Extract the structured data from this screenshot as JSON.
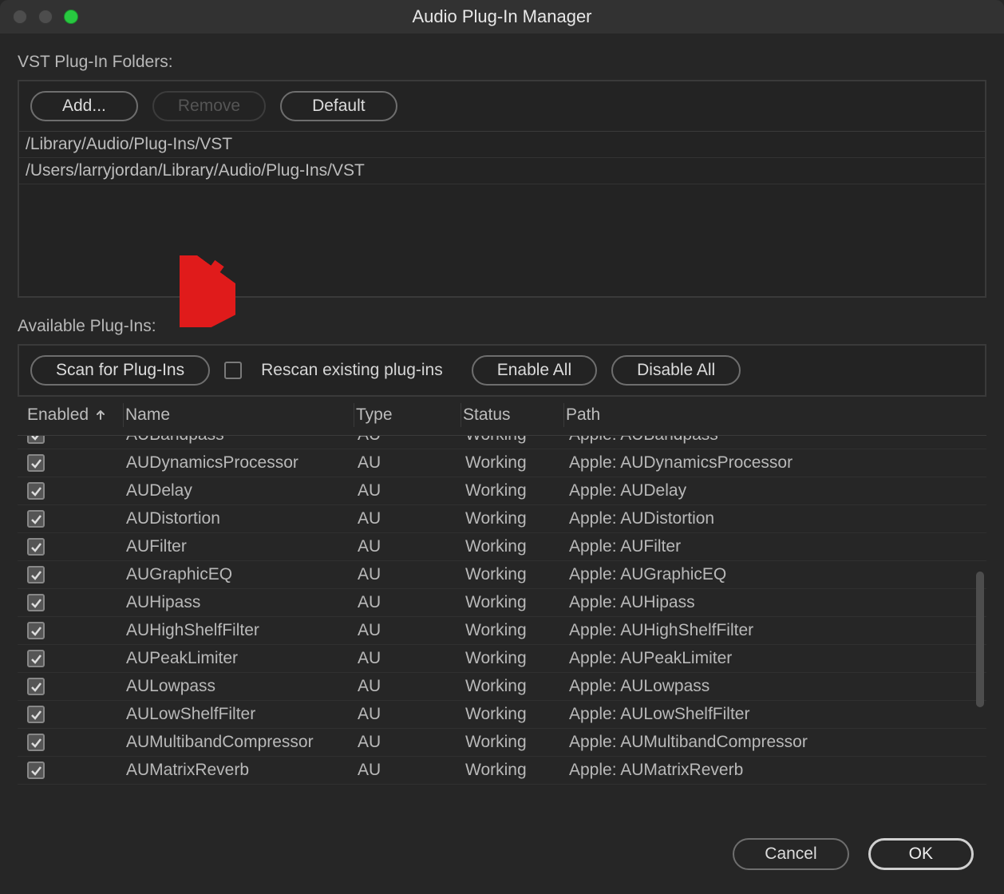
{
  "window": {
    "title": "Audio Plug-In Manager"
  },
  "folders": {
    "label": "VST Plug-In Folders:",
    "add": "Add...",
    "remove": "Remove",
    "default": "Default",
    "paths": [
      "/Library/Audio/Plug-Ins/VST",
      "/Users/larryjordan/Library/Audio/Plug-Ins/VST"
    ]
  },
  "available": {
    "label": "Available Plug-Ins:",
    "scan": "Scan for Plug-Ins",
    "rescan": "Rescan existing plug-ins",
    "enable_all": "Enable All",
    "disable_all": "Disable All"
  },
  "columns": {
    "enabled": "Enabled",
    "name": "Name",
    "type": "Type",
    "status": "Status",
    "path": "Path"
  },
  "plugins": [
    {
      "enabled": true,
      "name": "AUBandpass",
      "type": "AU",
      "status": "Working",
      "path": "Apple: AUBandpass"
    },
    {
      "enabled": true,
      "name": "AUDynamicsProcessor",
      "type": "AU",
      "status": "Working",
      "path": "Apple: AUDynamicsProcessor"
    },
    {
      "enabled": true,
      "name": "AUDelay",
      "type": "AU",
      "status": "Working",
      "path": "Apple: AUDelay"
    },
    {
      "enabled": true,
      "name": "AUDistortion",
      "type": "AU",
      "status": "Working",
      "path": "Apple: AUDistortion"
    },
    {
      "enabled": true,
      "name": "AUFilter",
      "type": "AU",
      "status": "Working",
      "path": "Apple: AUFilter"
    },
    {
      "enabled": true,
      "name": "AUGraphicEQ",
      "type": "AU",
      "status": "Working",
      "path": "Apple: AUGraphicEQ"
    },
    {
      "enabled": true,
      "name": "AUHipass",
      "type": "AU",
      "status": "Working",
      "path": "Apple: AUHipass"
    },
    {
      "enabled": true,
      "name": "AUHighShelfFilter",
      "type": "AU",
      "status": "Working",
      "path": "Apple: AUHighShelfFilter"
    },
    {
      "enabled": true,
      "name": "AUPeakLimiter",
      "type": "AU",
      "status": "Working",
      "path": "Apple: AUPeakLimiter"
    },
    {
      "enabled": true,
      "name": "AULowpass",
      "type": "AU",
      "status": "Working",
      "path": "Apple: AULowpass"
    },
    {
      "enabled": true,
      "name": "AULowShelfFilter",
      "type": "AU",
      "status": "Working",
      "path": "Apple: AULowShelfFilter"
    },
    {
      "enabled": true,
      "name": "AUMultibandCompressor",
      "type": "AU",
      "status": "Working",
      "path": "Apple: AUMultibandCompressor"
    },
    {
      "enabled": true,
      "name": "AUMatrixReverb",
      "type": "AU",
      "status": "Working",
      "path": "Apple: AUMatrixReverb"
    }
  ],
  "footer": {
    "cancel": "Cancel",
    "ok": "OK"
  }
}
